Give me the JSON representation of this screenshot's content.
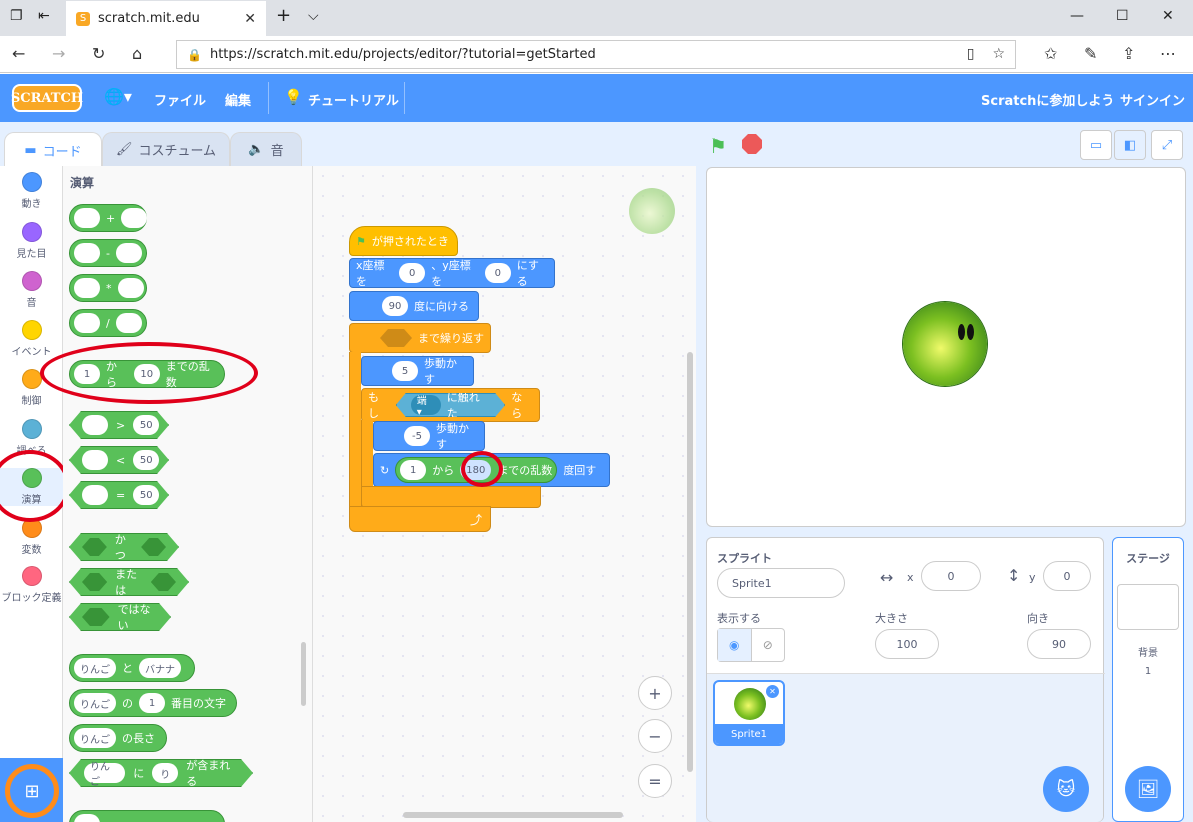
{
  "browser": {
    "tab_title": "scratch.mit.edu",
    "tab_close": "✕",
    "new_tab": "+",
    "tab_menu": "⌵",
    "url": "https://scratch.mit.edu/projects/editor/?tutorial=getStarted",
    "win_min": "—",
    "win_max": "☐",
    "win_close": "✕"
  },
  "menubar": {
    "logo": "SCRATCH",
    "file": "ファイル",
    "edit": "編集",
    "tutorial": "チュートリアル",
    "join": "Scratchに参加しよう",
    "signin": "サインイン"
  },
  "tabs": {
    "code": "コード",
    "costume": "コスチューム",
    "sound": "音"
  },
  "categories": [
    {
      "label": "動き",
      "color": "#4c97ff"
    },
    {
      "label": "見た目",
      "color": "#9966ff"
    },
    {
      "label": "音",
      "color": "#cf63cf"
    },
    {
      "label": "イベント",
      "color": "#ffd500"
    },
    {
      "label": "制御",
      "color": "#ffab19"
    },
    {
      "label": "調べる",
      "color": "#5cb1d6"
    },
    {
      "label": "演算",
      "color": "#59c059"
    },
    {
      "label": "変数",
      "color": "#ff8c1a"
    },
    {
      "label": "ブロック定義",
      "color": "#ff6680"
    }
  ],
  "palette": {
    "title": "演算",
    "plus": "+",
    "minus": "-",
    "times": "*",
    "divide": "/",
    "random": {
      "from": "1",
      "word_from": "から",
      "to": "10",
      "word_to": "までの乱数"
    },
    "gt": {
      "op": ">",
      "v": "50"
    },
    "lt": {
      "op": "<",
      "v": "50"
    },
    "eq": {
      "op": "=",
      "v": "50"
    },
    "and": "かつ",
    "or": "または",
    "not": "ではない",
    "join": {
      "a": "りんご",
      "word": "と",
      "b": "バナナ"
    },
    "letter": {
      "a": "りんご",
      "word1": "の",
      "n": "1",
      "word2": "番目の文字"
    },
    "length": {
      "a": "りんご",
      "word": "の長さ"
    },
    "contains": {
      "a": "りんご",
      "word1": "に",
      "b": "り",
      "word2": "が含まれる"
    }
  },
  "script": {
    "hat": "が押されたとき",
    "goto": {
      "w1": "x座標を",
      "x": "0",
      "w2": "、y座標を",
      "y": "0",
      "w3": "にする"
    },
    "point": {
      "v": "90",
      "w": "度に向ける"
    },
    "repeat_until": "まで繰り返す",
    "move1": {
      "v": "5",
      "w": "歩動かす"
    },
    "if": {
      "w1": "もし",
      "edge": "端 ▾",
      "w2": "に触れた",
      "w3": "なら"
    },
    "move2": {
      "v": "-5",
      "w": "歩動かす"
    },
    "turn": {
      "from": "1",
      "w1": "から",
      "to": "180",
      "w2": "までの乱数",
      "w3": "度回す"
    },
    "zoom_in": "+",
    "zoom_out": "−",
    "zoom_reset": "="
  },
  "sprite_info": {
    "title": "スプライト",
    "name": "Sprite1",
    "x_label": "x",
    "x": "0",
    "y_label": "y",
    "y": "0",
    "show_label": "表示する",
    "size_label": "大きさ",
    "size": "100",
    "direction_label": "向き",
    "direction": "90",
    "thumb_label": "Sprite1"
  },
  "stage_panel": {
    "title": "ステージ",
    "backdrop_label": "背景",
    "backdrop_count": "1"
  },
  "colors": {
    "scratch_blue": "#4c97ff",
    "operators_green": "#59c059",
    "highlight_red": "#e0001a",
    "highlight_orange": "#ff8c1a"
  }
}
